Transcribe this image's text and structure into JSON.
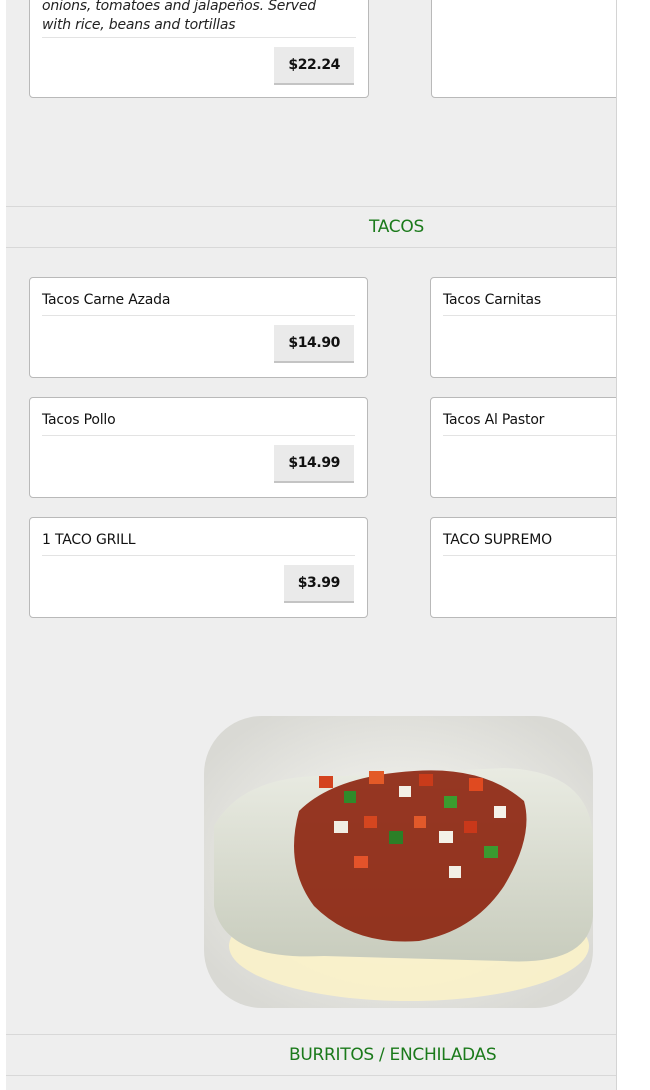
{
  "top_item": {
    "description": "onions, tomatoes and jalapeños. Served with rice, beans and tortillas",
    "price": "$22.24"
  },
  "sections": [
    {
      "title": "TACOS",
      "items": [
        {
          "name": "Tacos Carne Azada",
          "price": "$14.90"
        },
        {
          "name": "Tacos Carnitas",
          "price": ""
        },
        {
          "name": "Tacos Pollo",
          "price": "$14.99"
        },
        {
          "name": "Tacos Al Pastor",
          "price": ""
        },
        {
          "name": "1 TACO GRILL",
          "price": "$3.99"
        },
        {
          "name": "TACO SUPREMO",
          "price": ""
        }
      ]
    },
    {
      "title": "BURRITOS / ENCHILADAS",
      "image": "burrito-photo"
    }
  ],
  "colors": {
    "panel_bg": "#eeeeee",
    "section_title": "#1b7a1b",
    "price_button_bg": "#eaeaea"
  }
}
